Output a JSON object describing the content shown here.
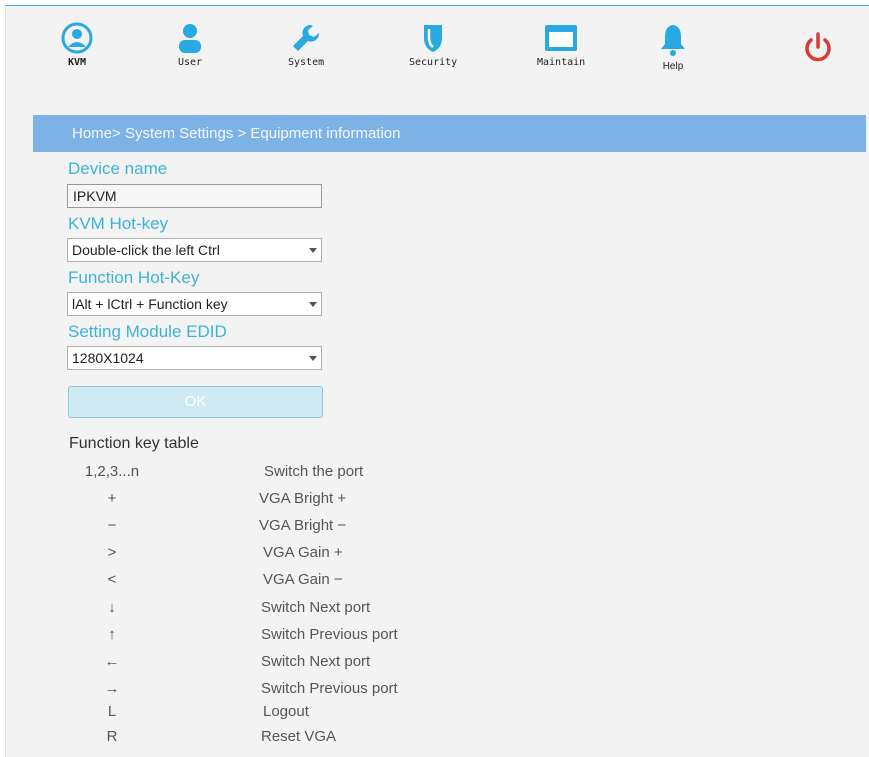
{
  "nav": {
    "items": [
      {
        "label": "KVM",
        "icon": "kvm-user-circle-icon"
      },
      {
        "label": "User",
        "icon": "user-icon"
      },
      {
        "label": "System",
        "icon": "wrench-icon"
      },
      {
        "label": "Security",
        "icon": "shield-icon"
      },
      {
        "label": "Maintain",
        "icon": "monitor-icon"
      },
      {
        "label": "Help",
        "icon": "bell-icon"
      }
    ],
    "power_icon": "power-icon"
  },
  "breadcrumb": "Home> System Settings > Equipment information",
  "form": {
    "device_name_label": "Device name",
    "device_name_value": "IPKVM",
    "kvm_hotkey_label": "KVM Hot-key",
    "kvm_hotkey_value": "Double-click the left Ctrl",
    "function_hotkey_label": "Function Hot-Key",
    "function_hotkey_value": "lAlt + lCtrl + Function key",
    "edid_label": "Setting Module EDID",
    "edid_value": "1280X1024",
    "ok_label": "OK"
  },
  "function_key_table": {
    "title": "Function key table",
    "rows": [
      {
        "key": "1,2,3...n",
        "desc": "Switch the port"
      },
      {
        "key": "+",
        "desc": "VGA Bright +"
      },
      {
        "key": "−",
        "desc": "VGA Bright −"
      },
      {
        "key": ">",
        "desc": "VGA Gain +"
      },
      {
        "key": "<",
        "desc": "VGA Gain −"
      },
      {
        "key": "↓",
        "desc": "Switch Next port"
      },
      {
        "key": "↑",
        "desc": "Switch Previous port"
      },
      {
        "key": "←",
        "desc": "Switch Next port"
      },
      {
        "key": "→",
        "desc": "Switch Previous port"
      },
      {
        "key": "L",
        "desc": "Logout"
      },
      {
        "key": "R",
        "desc": "Reset VGA"
      }
    ]
  },
  "colors": {
    "accent": "#3cb4d8",
    "nav_icon": "#29a9e1",
    "breadcrumb_bg": "#7cb2e6",
    "power": "#d93a36"
  }
}
